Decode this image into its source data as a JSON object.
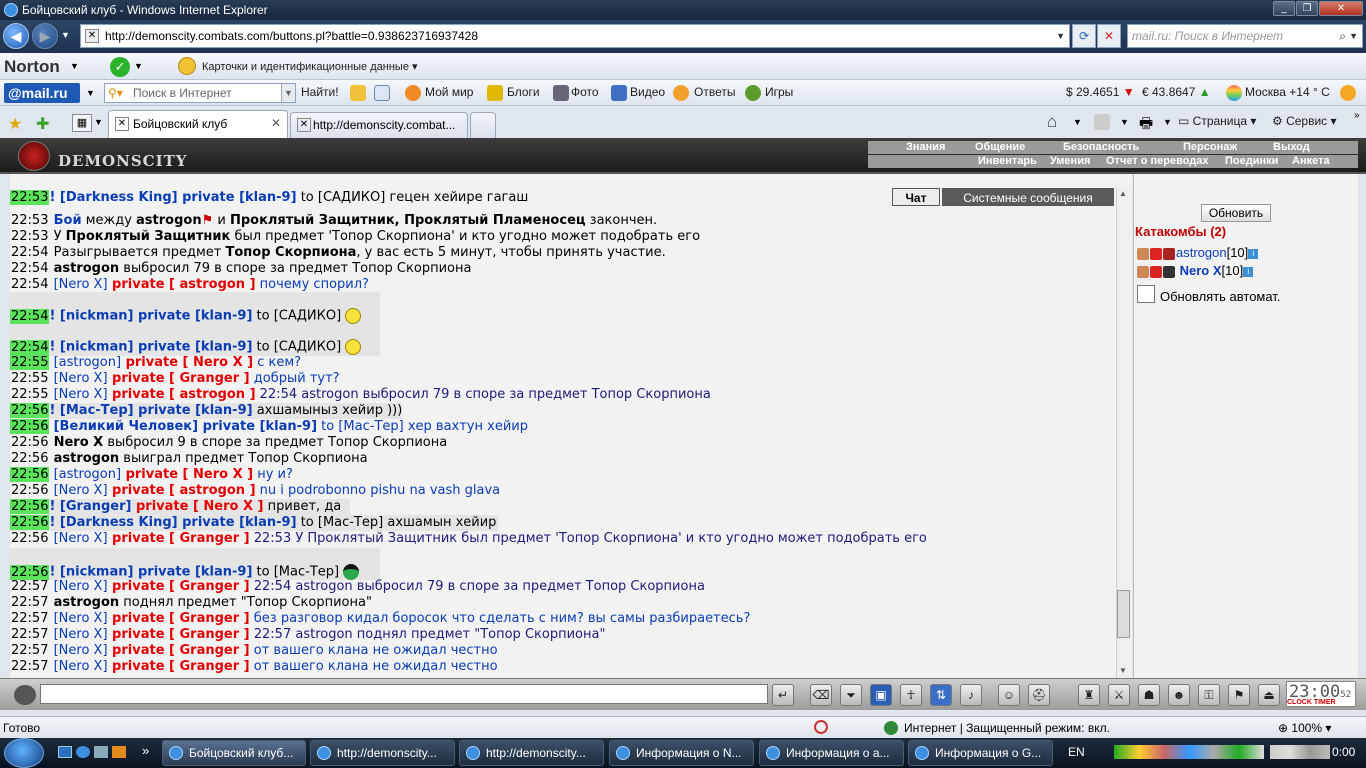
{
  "window": {
    "title": "Бойцовский клуб - Windows Internet Explorer"
  },
  "address": {
    "url": "http://demonscity.combats.com/buttons.pl?battle=0.938623716937428",
    "search_placeholder": "mail.ru: Поиск в Интернет"
  },
  "norton": {
    "brand": "Norton",
    "cards_label": "Карточки и идентификационные данные"
  },
  "mailbar": {
    "brand": "@mail.ru",
    "search_placeholder": "Поиск в Интернет",
    "find_label": "Найти!",
    "links": [
      "Мой мир",
      "Блоги",
      "Фото",
      "Видео",
      "Ответы",
      "Игры"
    ],
    "usd": "$ 29.4651",
    "eur": "€ 43.8647",
    "weather": "Москва +14 ° C"
  },
  "tabs": [
    {
      "label": "Бойцовский клуб"
    },
    {
      "label": "http://demonscity.combat..."
    }
  ],
  "commandbar": {
    "page": "Страница",
    "tools": "Сервис"
  },
  "game": {
    "logo": "DEMONSCITY",
    "menu_top": [
      "Знания",
      "Общение",
      "Безопасность",
      "Персонаж",
      "Выход"
    ],
    "menu_bottom": [
      "Инвентарь",
      "Умения",
      "Отчет о переводах",
      "Поединки",
      "Анкета"
    ],
    "chat_tabs": [
      "Чат",
      "Системные сообщения"
    ]
  },
  "chat": {
    "lines": [
      {
        "t": "22:53",
        "a": "! [Darkness King]",
        "b": " private [klan-9]",
        "c": " to [САДИКО] гецен хейире гагаш"
      },
      {
        "t": "22:53",
        "a": "Бой",
        "b": " между ",
        "c": "astrogon",
        "d": " и ",
        "e": "Проклятый Защитник, Проклятый Пламеносец",
        "f": " закончен."
      },
      {
        "t": "22:53",
        "a": " У ",
        "b": "Проклятый Защитник",
        "c": " был предмет 'Топор Скорпиона' и кто угодно может подобрать его"
      },
      {
        "t": "22:54",
        "a": " Разыгрывается предмет ",
        "b": "Топор Скорпиона",
        "c": ", у вас есть 5 минут, чтобы принять участие."
      },
      {
        "t": "22:54",
        "a": "astrogon",
        "b": " выбросил 79 в споре за предмет Топор Скорпиона"
      },
      {
        "t": "22:54",
        "a": "[Nero X]",
        "b": " private [ astrogon ]",
        "c": " почему спорил?"
      },
      {
        "t": "22:54",
        "a": "! [nickman]",
        "b": " private [klan-9]",
        "c": " to [САДИКО]"
      },
      {
        "t": "22:54",
        "a": "! [nickman]",
        "b": " private [klan-9]",
        "c": " to [САДИКО]"
      },
      {
        "t": "22:55",
        "a": "[astrogon]",
        "b": " private [ Nero X ]",
        "c": " с кем?"
      },
      {
        "t": "22:55",
        "a": "[Nero X]",
        "b": " private [ Granger ]",
        "c": " добрый тут?"
      },
      {
        "t": "22:55",
        "a": "[Nero X]",
        "b": " private [ astrogon ]",
        "c": " 22:54 astrogon выбросил 79 в споре за предмет Топор Скорпиона"
      },
      {
        "t": "22:56",
        "a": "! [Мас-Тер]",
        "b": " private [klan-9]",
        "c": " ахшамыныз хейир )))"
      },
      {
        "t": "22:56",
        "a": "[Великий Человек]",
        "b": " private [klan-9]",
        "c": " to [Мас-Тер] хер вахтун хейир"
      },
      {
        "t": "22:56",
        "a": "Nero X",
        "b": " выбросил 9 в споре за предмет Топор Скорпиона"
      },
      {
        "t": "22:56",
        "a": "astrogon",
        "b": " выиграл предмет Топор Скорпиона"
      },
      {
        "t": "22:56",
        "a": "[astrogon]",
        "b": " private [ Nero X ]",
        "c": " ну и?"
      },
      {
        "t": "22:56",
        "a": "[Nero X]",
        "b": " private [ astrogon ]",
        "c": " nu i podrobonno pishu na vash glava"
      },
      {
        "t": "22:56",
        "a": "! [Granger]",
        "b": " private [ Nero X ]",
        "c": " привет, да"
      },
      {
        "t": "22:56",
        "a": "! [Darkness King]",
        "b": " private [klan-9]",
        "c": " to [Мас-Тер] ахшамын хейир"
      },
      {
        "t": "22:56",
        "a": "[Nero X]",
        "b": " private [ Granger ]",
        "c": " 22:53 У Проклятый Защитник был предмет 'Топор Скорпиона' и кто угодно может подобрать его"
      },
      {
        "t": "22:56",
        "a": "! [nickman]",
        "b": " private [klan-9]",
        "c": " to [Мас-Тер]"
      },
      {
        "t": "22:57",
        "a": "[Nero X]",
        "b": " private [ Granger ]",
        "c": " 22:54 astrogon выбросил 79 в споре за предмет Топор Скорпиона"
      },
      {
        "t": "22:57",
        "a": "astrogon",
        "b": " поднял предмет \"Топор Скорпиона\""
      },
      {
        "t": "22:57",
        "a": "[Nero X]",
        "b": " private [ Granger ]",
        "c": " без разговор кидал боросок что сделать с ним? вы самы разбираетесь?"
      },
      {
        "t": "22:57",
        "a": "[Nero X]",
        "b": " private [ Granger ]",
        "c": " 22:57 astrogon поднял предмет \"Топор Скорпиона\""
      },
      {
        "t": "22:57",
        "a": "[Nero X]",
        "b": " private [ Granger ]",
        "c": " от вашего клана не ожидал честно"
      },
      {
        "t": "22:57",
        "a": "[Nero X]",
        "b": " private [ Granger ]",
        "c": " от вашего клана не ожидал честно"
      }
    ]
  },
  "room": {
    "refresh_label": "Обновить",
    "title": "Катакомбы (2)",
    "players": [
      {
        "name": "astrogon",
        "level": "[10]"
      },
      {
        "name": "Nero X",
        "level": "[10]"
      }
    ],
    "auto_label": "Обновлять автомат."
  },
  "clock": {
    "time": "23:00",
    "sec": "52",
    "label": "CLOCK TIMER"
  },
  "statusbar": {
    "left": "Готово",
    "zone": "Интернет | Защищенный режим: вкл.",
    "zoom": "100%"
  },
  "taskbar": {
    "items": [
      "Бойцовский клуб...",
      "http://demonscity...",
      "http://demonscity...",
      "Информация о N...",
      "Информация о а...",
      "Информация о G..."
    ],
    "lang": "EN",
    "time": "0:00"
  }
}
